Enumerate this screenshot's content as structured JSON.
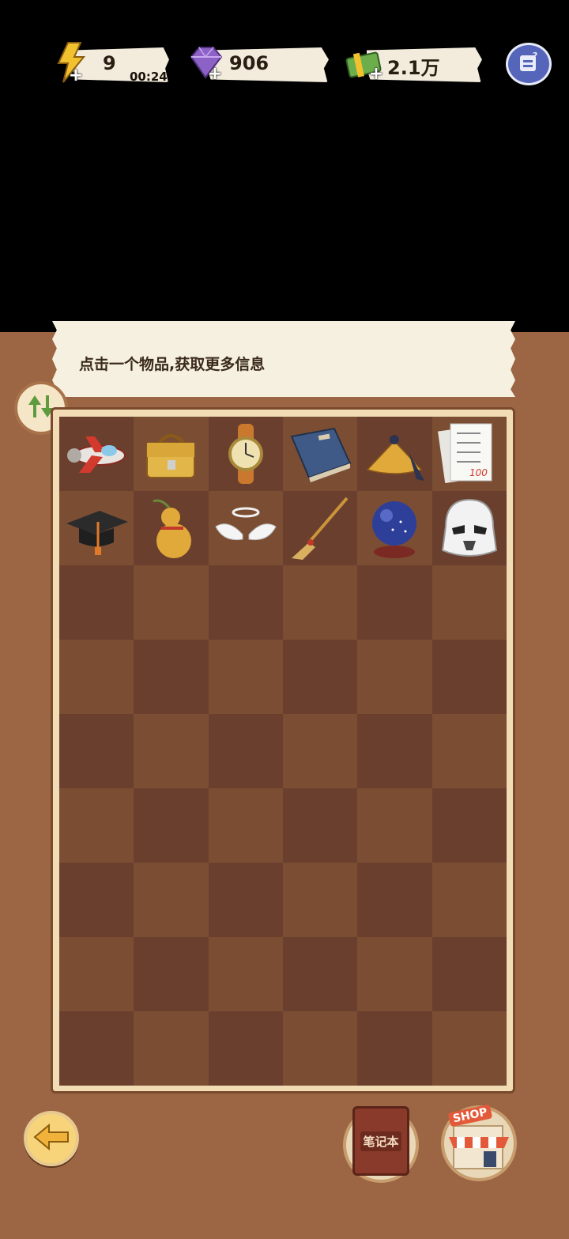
{
  "resources": {
    "energy": {
      "value": "9",
      "timer": "00:24",
      "icon": "lightning-icon",
      "color": "#f2c12e"
    },
    "gems": {
      "value": "906",
      "icon": "gem-icon",
      "color": "#8d62c6"
    },
    "cash": {
      "value": "2.1万",
      "icon": "cash-icon",
      "color": "#6cae4c"
    }
  },
  "menu": {
    "icon": "help-menu-icon"
  },
  "banner": {
    "text": "点击一个物品,获取更多信息"
  },
  "inventory": {
    "columns": 6,
    "rows": 9,
    "items": [
      {
        "name": "toy-airplane"
      },
      {
        "name": "leather-handbag"
      },
      {
        "name": "wristwatch"
      },
      {
        "name": "old-book"
      },
      {
        "name": "feather-fan"
      },
      {
        "name": "test-paper"
      },
      {
        "name": "graduation-cap"
      },
      {
        "name": "gourd"
      },
      {
        "name": "angel-wings-halo"
      },
      {
        "name": "broom"
      },
      {
        "name": "crystal-ball"
      },
      {
        "name": "stormtrooper-helmet"
      }
    ],
    "test_paper_score": "100"
  },
  "buttons": {
    "notebook_label": "笔记本",
    "shop_label": "SHOP"
  }
}
